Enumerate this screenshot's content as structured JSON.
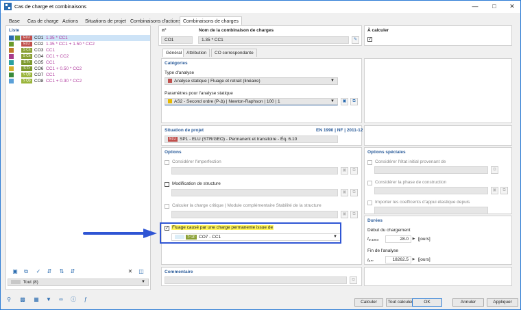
{
  "window": {
    "title": "Cas de charge et combinaisons"
  },
  "top_tabs": [
    "Base",
    "Cas de charge",
    "Actions",
    "Situations de projet",
    "Combinaisons d'actions",
    "Combinaisons de charges"
  ],
  "list": {
    "label": "Liste",
    "items": [
      {
        "badge": "ELU",
        "badge_type": "elu",
        "id": "CO1",
        "name": "1.35 * CC1"
      },
      {
        "badge": "ELU",
        "badge_type": "elu",
        "id": "CO2",
        "name": "1.35 * CC1 + 1.50 * CC2"
      },
      {
        "badge": "S Ch",
        "badge_type": "sch",
        "id": "CO3",
        "name": "CC1"
      },
      {
        "badge": "S Ch",
        "badge_type": "sch",
        "id": "CO4",
        "name": "CC1 + CC2"
      },
      {
        "badge": "S Fr",
        "badge_type": "sfr",
        "id": "CO5",
        "name": "CC1"
      },
      {
        "badge": "S Fr",
        "badge_type": "sfr",
        "id": "CO6",
        "name": "CC1 + 0.50 * CC2"
      },
      {
        "badge": "S Qp",
        "badge_type": "sqp",
        "id": "CO7",
        "name": "CC1"
      },
      {
        "badge": "S Qp",
        "badge_type": "sqp",
        "id": "CO8",
        "name": "CC1 + 0.30 * CC2"
      }
    ],
    "filter": "Tout (8)"
  },
  "header": {
    "no_label": "n°",
    "no_value": "CO1",
    "name_label": "Nom de la combinaison de charges",
    "name_value": "1.35 * CC1",
    "calc_label": "À calculer"
  },
  "sub_tabs": [
    "Général",
    "Attribution",
    "CO correspondante"
  ],
  "categories": {
    "title": "Catégories",
    "analysis_type_label": "Type d'analyse",
    "analysis_type_value": "Analyse statique | Fluage et retrait (linéaire)",
    "params_label": "Paramètres pour l'analyse statique",
    "params_value": "AS2 - Second ordre (P-Δ) | Newton-Raphson | 100 | 1"
  },
  "design_situation": {
    "title": "Situation de projet",
    "norm": "EN 1990 | NF | 2011-12",
    "badge": "ELU",
    "value": "SP1 - ELU (STR/GEO) - Permanent et transitoire - Éq. 6.10"
  },
  "options": {
    "title": "Options",
    "imperfection": "Considérer l'imperfection",
    "structure_mod": "Modification de structure",
    "critical_load": "Calculer la charge critique | Module complémentaire Stabilité de la structure",
    "creep": "Fluage causé par une charge permanente issue de",
    "creep_badge": "S Qp",
    "creep_value": "CO7 - CC1"
  },
  "special_options": {
    "title": "Options spéciales",
    "initial_state": "Considérer l'état initial provenant de",
    "construction_phase": "Considérer la phase de construction",
    "elastic_support": "Importer les coefficents d'appui élastique depuis"
  },
  "durations": {
    "title": "Durées",
    "start_label": "Début du chargement",
    "start_symbol": "t₀,₁₀ₐ₄",
    "start_value": "28.0",
    "start_unit": "[jours]",
    "end_label": "Fin de l'analyse",
    "end_symbol": "tₒₘ",
    "end_value": "18262.5",
    "end_unit": "[jours]"
  },
  "comment": {
    "title": "Commentaire"
  },
  "buttons": {
    "calculate": "Calculer",
    "calculate_all": "Tout calculer",
    "ok": "OK",
    "cancel": "Annuler",
    "apply": "Appliquer"
  }
}
